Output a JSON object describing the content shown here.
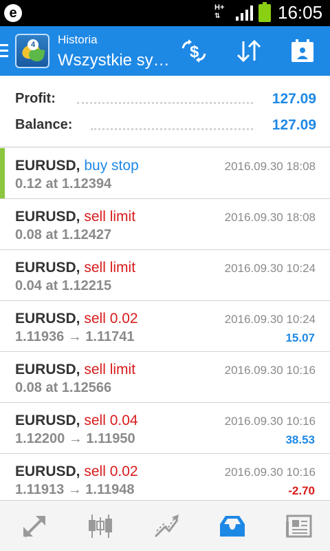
{
  "status_bar": {
    "app_badge": "e",
    "network": "H+",
    "time": "16:05"
  },
  "header": {
    "subtitle": "Historia",
    "title": "Wszystkie sy…",
    "logo_badge": "4"
  },
  "summary": {
    "profit_label": "Profit:",
    "profit_value": "127.09",
    "balance_label": "Balance:",
    "balance_value": "127.09"
  },
  "orders": [
    {
      "symbol": "EURUSD,",
      "type": "buy stop",
      "kind": "buy",
      "detail": "0.12 at 1.12394",
      "time": "2016.09.30 18:08",
      "profit": "",
      "selected": true
    },
    {
      "symbol": "EURUSD,",
      "type": "sell limit",
      "kind": "sell",
      "detail": "0.08 at 1.12427",
      "time": "2016.09.30 18:08",
      "profit": ""
    },
    {
      "symbol": "EURUSD,",
      "type": "sell limit",
      "kind": "sell",
      "detail": "0.04 at 1.12215",
      "time": "2016.09.30 10:24",
      "profit": ""
    },
    {
      "symbol": "EURUSD,",
      "type": "sell 0.02",
      "kind": "sell",
      "detail": "1.11936 → 1.11741",
      "time": "2016.09.30 10:24",
      "profit": "15.07"
    },
    {
      "symbol": "EURUSD,",
      "type": "sell limit",
      "kind": "sell",
      "detail": "0.08 at 1.12566",
      "time": "2016.09.30 10:16",
      "profit": ""
    },
    {
      "symbol": "EURUSD,",
      "type": "sell 0.04",
      "kind": "sell",
      "detail": "1.12200 → 1.11950",
      "time": "2016.09.30 10:16",
      "profit": "38.53"
    },
    {
      "symbol": "EURUSD,",
      "type": "sell 0.02",
      "kind": "sell",
      "detail": "1.11913 → 1.11948",
      "time": "2016.09.30 10:16",
      "profit": "-2.70"
    }
  ],
  "bottom_nav": [
    {
      "icon": "quotes-icon"
    },
    {
      "icon": "chart-icon"
    },
    {
      "icon": "trade-icon"
    },
    {
      "icon": "history-icon",
      "active": true
    },
    {
      "icon": "news-icon"
    }
  ],
  "colors": {
    "accent": "#1e88e5",
    "sell": "#d81b1b",
    "selected_marker": "#8cc63f"
  }
}
